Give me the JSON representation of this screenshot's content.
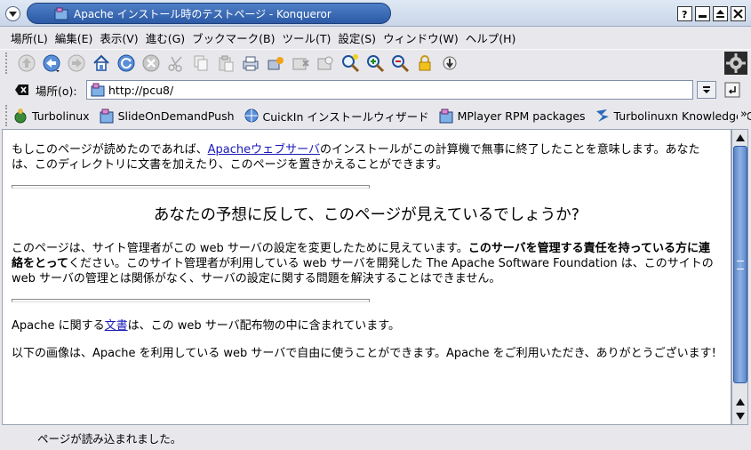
{
  "window": {
    "title": "Apache インストール時のテストページ - Konqueror"
  },
  "menubar": {
    "items": [
      "場所(L)",
      "編集(E)",
      "表示(V)",
      "進む(G)",
      "ブックマーク(B)",
      "ツール(T)",
      "設定(S)",
      "ウィンドウ(W)",
      "ヘルプ(H)"
    ]
  },
  "locationbar": {
    "label": "場所(o):",
    "url": "http://pcu8/"
  },
  "bookmarks": {
    "items": [
      "Turbolinux",
      "SlideOnDemandPush",
      "CuickIn インストールウィザード",
      "MPlayer RPM packages",
      "Turbolinuxn Knowledge C"
    ],
    "more": "»"
  },
  "content": {
    "p1": {
      "before": "もしこのページが読めたのであれば、",
      "link": "Apacheウェブサーバ",
      "after": "のインストールがこの計算機で無事に終了したことを意味します。あなたは、このディレクトリに文書を加えたり、このページを置きかえることができます。"
    },
    "heading": "あなたの予想に反して、このページが見えているでしょうか?",
    "p2": {
      "before": "このページは、サイト管理者がこの web サーバの設定を変更したために見えています。",
      "bold": "このサーバを管理する責任を持っている方に連絡をとって",
      "after": "ください。このサイト管理者が利用している web サーバを開発した The Apache Software Foundation は、このサイトの web サーバの管理とは関係がなく、サーバの設定に関する問題を解決することはできません。"
    },
    "p3": {
      "before": "Apache に関する",
      "link": "文書",
      "after": "は、この web サーバ配布物の中に含まれています。"
    },
    "p4": "以下の画像は、Apache を利用している web サーバで自由に使うことができます。Apache をご利用いただき、ありがとうございます!"
  },
  "status": {
    "text": "ページが読み込まれました。"
  },
  "colors": {
    "title_pill": "#2c5aa6",
    "link": "#1a1ab8",
    "scroll_thumb": "#5b86c8"
  }
}
